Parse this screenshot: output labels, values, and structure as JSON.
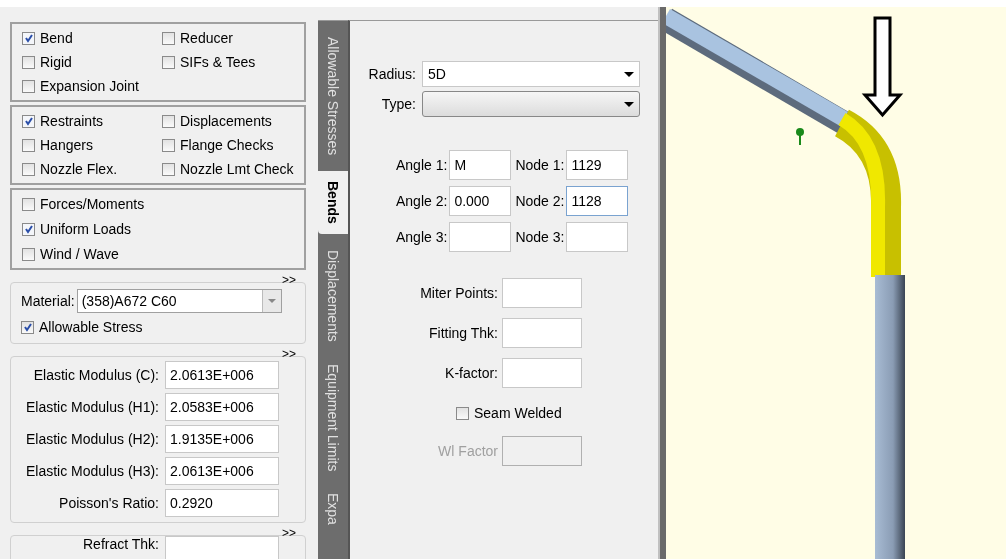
{
  "element_groups": [
    {
      "items": [
        {
          "label": "Bend",
          "checked": true
        },
        {
          "label": "Reducer",
          "checked": false
        },
        {
          "label": "Rigid",
          "checked": false
        },
        {
          "label": "SIFs & Tees",
          "checked": false
        },
        {
          "label": "Expansion Joint",
          "checked": false
        }
      ]
    },
    {
      "items": [
        {
          "label": "Restraints",
          "checked": true
        },
        {
          "label": "Displacements",
          "checked": false
        },
        {
          "label": "Hangers",
          "checked": false
        },
        {
          "label": "Flange Checks",
          "checked": false
        },
        {
          "label": "Nozzle Flex.",
          "checked": false
        },
        {
          "label": "Nozzle Lmt Check",
          "checked": false
        }
      ]
    },
    {
      "items": [
        {
          "label": "Forces/Moments",
          "checked": false
        },
        {
          "label": "Uniform Loads",
          "checked": true
        },
        {
          "label": "Wind / Wave",
          "checked": false
        }
      ]
    }
  ],
  "material_panel": {
    "expander": ">>",
    "label": "Material:",
    "value": "(358)A672 C60",
    "allowable_stress": {
      "label": "Allowable Stress",
      "checked": true
    }
  },
  "modulus_panel": {
    "expander": ">>",
    "fields": [
      {
        "label": "Elastic Modulus (C):",
        "value": "2.0613E+006"
      },
      {
        "label": "Elastic Modulus (H1):",
        "value": "2.0583E+006"
      },
      {
        "label": "Elastic Modulus (H2):",
        "value": "1.9135E+006"
      },
      {
        "label": "Elastic Modulus (H3):",
        "value": "2.0613E+006"
      },
      {
        "label": "Poisson's Ratio:",
        "value": "0.2920"
      }
    ]
  },
  "refract_panel": {
    "expander": ">>",
    "label": "Refract Thk:"
  },
  "tabs": [
    {
      "label": "Allowable Stresses",
      "selected": false
    },
    {
      "label": "Bends",
      "selected": true
    },
    {
      "label": "Displacements",
      "selected": false
    },
    {
      "label": "Equipment Limits",
      "selected": false
    },
    {
      "label": "Expa",
      "selected": false
    }
  ],
  "bends": {
    "radius": {
      "label": "Radius:",
      "value": "5D"
    },
    "type": {
      "label": "Type:"
    },
    "angles": [
      {
        "label": "Angle 1:",
        "value": "M"
      },
      {
        "label": "Angle 2:",
        "value": "0.000"
      },
      {
        "label": "Angle 3:"
      }
    ],
    "nodes": [
      {
        "label": "Node 1:",
        "value": "1129"
      },
      {
        "label": "Node 2:",
        "value": "1128"
      },
      {
        "label": "Node 3:"
      }
    ],
    "fields": [
      {
        "label": "Miter Points:"
      },
      {
        "label": "Fitting Thk:"
      },
      {
        "label": "K-factor:"
      }
    ],
    "seam_welded": {
      "label": "Seam Welded",
      "checked": false
    },
    "wl_factor": {
      "label": "Wl Factor",
      "disabled": true
    }
  }
}
